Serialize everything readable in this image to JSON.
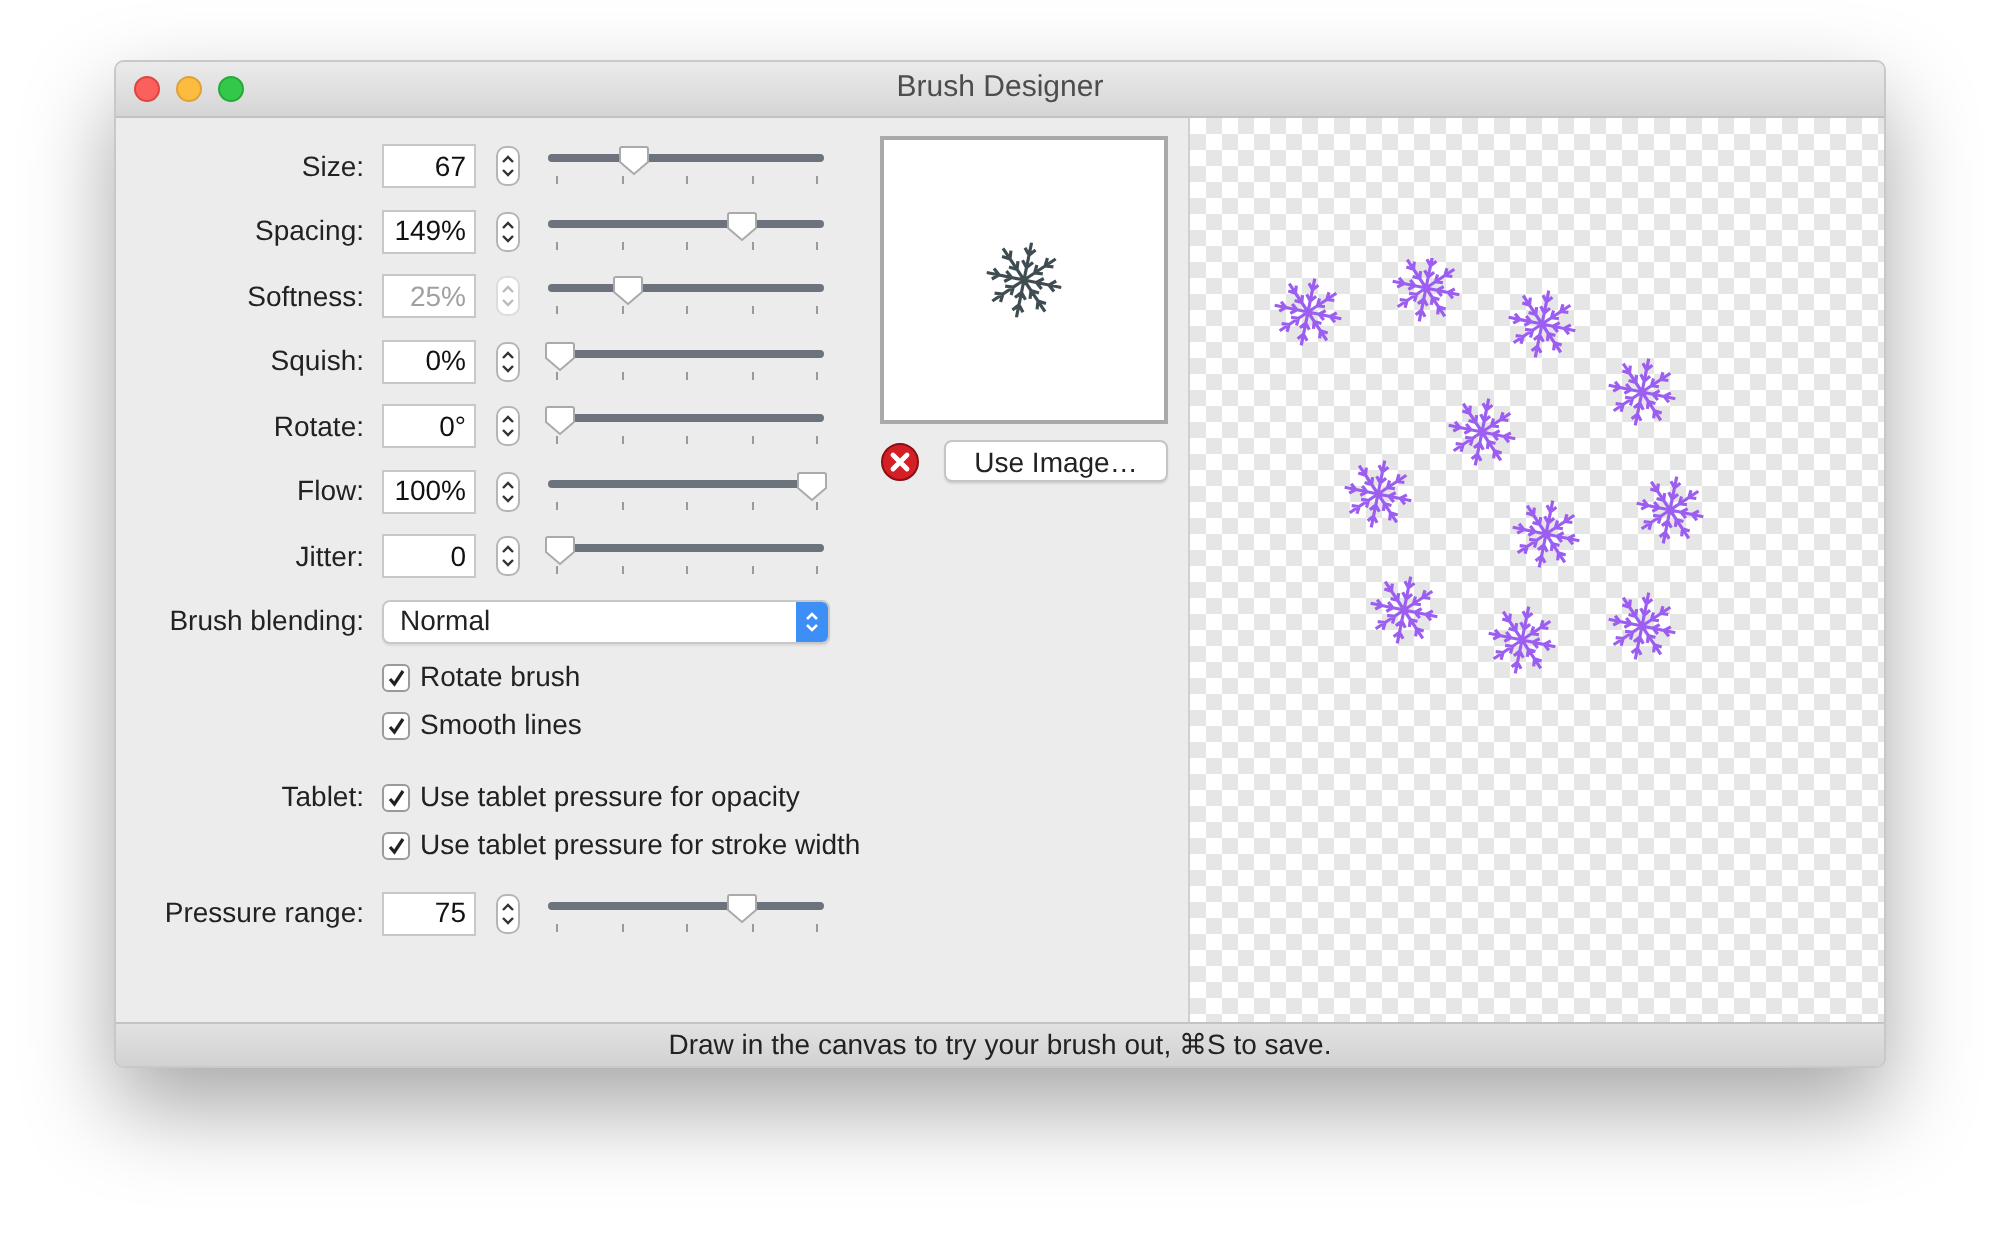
{
  "window": {
    "title": "Brush Designer"
  },
  "sliders": [
    {
      "label": "Size:",
      "value": "67",
      "disabled": false,
      "level": 0.29
    },
    {
      "label": "Spacing:",
      "value": "149%",
      "disabled": false,
      "level": 0.72
    },
    {
      "label": "Softness:",
      "value": "25%",
      "disabled": true,
      "level": 0.27
    },
    {
      "label": "Squish:",
      "value": "0%",
      "disabled": false,
      "level": 0
    },
    {
      "label": "Rotate:",
      "value": "0°",
      "disabled": false,
      "level": 0
    },
    {
      "label": "Flow:",
      "value": "100%",
      "disabled": false,
      "level": 1
    },
    {
      "label": "Jitter:",
      "value": "0",
      "disabled": false,
      "level": 0
    }
  ],
  "blending": {
    "label": "Brush blending:",
    "value": "Normal"
  },
  "options": [
    {
      "label": "Rotate brush",
      "checked": true
    },
    {
      "label": "Smooth lines",
      "checked": true
    }
  ],
  "tablet": {
    "label": "Tablet:",
    "options": [
      {
        "label": "Use tablet pressure for opacity",
        "checked": true
      },
      {
        "label": "Use tablet pressure for stroke width",
        "checked": true
      }
    ]
  },
  "pressure": {
    "label": "Pressure range:",
    "value": "75",
    "disabled": false,
    "level": 0.72
  },
  "use_image_button": "Use Image…",
  "status_bar": "Draw in the canvas to try your brush out, ⌘S to save."
}
